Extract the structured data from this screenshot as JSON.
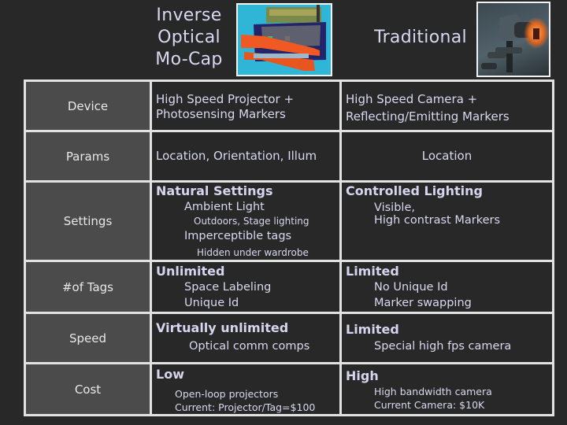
{
  "header": {
    "inverse_title": "Inverse Optical Mo-Cap",
    "inverse_title_lines": [
      "Inverse",
      "Optical",
      "Mo-Cap"
    ],
    "traditional_title": "Traditional",
    "inverse_image": "projector-photo",
    "traditional_image": "camera-photo"
  },
  "rows": [
    {
      "label": "Device",
      "inverse": {
        "lines": [
          "High Speed Projector +",
          "Photosensing Markers"
        ]
      },
      "traditional": {
        "lines": [
          "High Speed Camera +",
          "Reflecting/Emitting Markers"
        ]
      }
    },
    {
      "label": "Params",
      "inverse": {
        "text": "Location, Orientation, Illum"
      },
      "traditional": {
        "text": "Location"
      }
    },
    {
      "label": "Settings",
      "inverse": {
        "head": "Natural Settings",
        "sub1": "Ambient Light",
        "tiny1": "Outdoors, Stage lighting",
        "sub2": "Imperceptible tags",
        "tiny2": "Hidden under wardrobe"
      },
      "traditional": {
        "head": "Controlled Lighting",
        "sub1": "Visible,",
        "sub2": "High contrast Markers"
      }
    },
    {
      "label": "#of Tags",
      "inverse": {
        "head": "Unlimited",
        "sub1": "Space Labeling",
        "sub2": "Unique Id"
      },
      "traditional": {
        "head": "Limited",
        "sub1": "No Unique Id",
        "sub2": "Marker swapping"
      }
    },
    {
      "label": "Speed",
      "inverse": {
        "head": "Virtually unlimited",
        "sub1": "Optical comm comps"
      },
      "traditional": {
        "head": "Limited",
        "sub1": "Special high fps camera"
      }
    },
    {
      "label": "Cost",
      "inverse": {
        "head": "Low",
        "sub1": "Open-loop projectors",
        "sub2": "Current: Projector/Tag=$100"
      },
      "traditional": {
        "head": "High",
        "sub1": "High bandwidth camera",
        "sub2": "Current Camera: $10K"
      }
    }
  ]
}
